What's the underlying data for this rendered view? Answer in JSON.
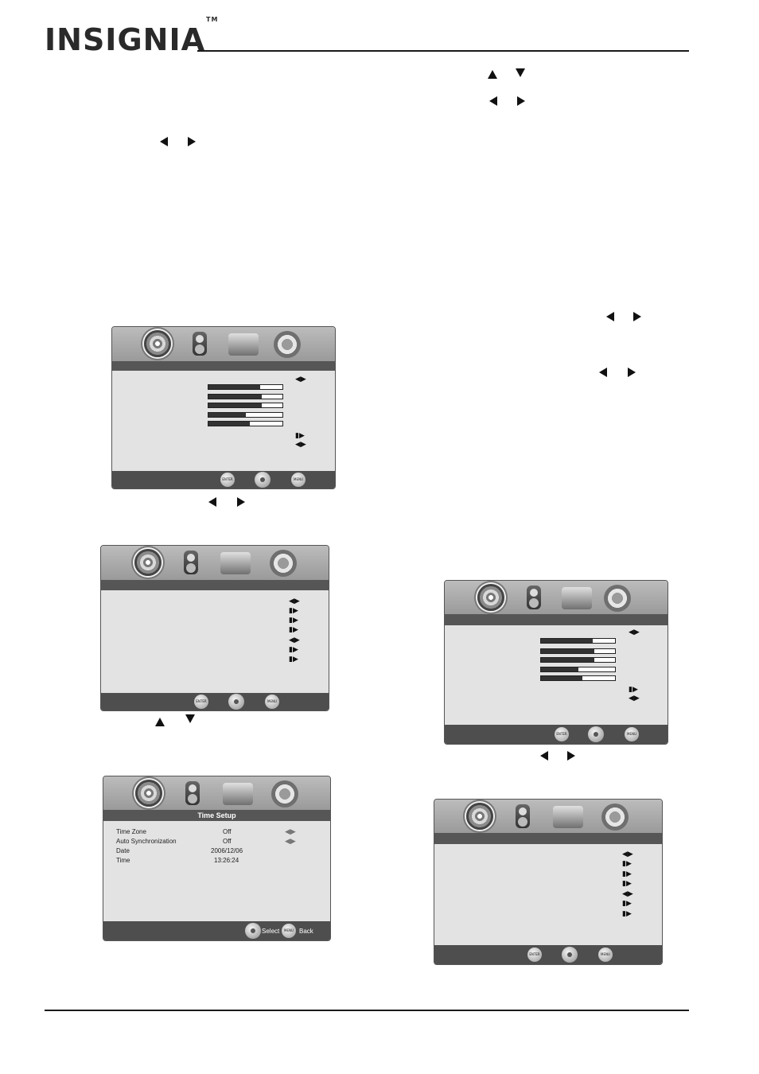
{
  "brand": {
    "name": "INSIGNIA",
    "mark": "TM"
  },
  "time_setup": {
    "title": "Time Setup",
    "rows": [
      {
        "label": "Time Zone",
        "value": "Off"
      },
      {
        "label": "Auto Synchronization",
        "value": "Off"
      },
      {
        "label": "Date",
        "value": "2006/12/06"
      },
      {
        "label": "Time",
        "value": "13:26:24"
      }
    ],
    "footer": {
      "select_label": "Select",
      "back_label": "Back",
      "menu_button": "MENU"
    }
  },
  "buttons": {
    "enter": "ENTER",
    "menu": "MENU"
  },
  "markers": {
    "lr": "◀▶",
    "pr": "▮▶"
  },
  "picture_menu": {
    "bar_levels": [
      0.7,
      0.72,
      0.72,
      0.5,
      0.56
    ]
  },
  "icons": [
    "disc-icon",
    "speaker-icon",
    "tools-icon",
    "gear-icon"
  ]
}
